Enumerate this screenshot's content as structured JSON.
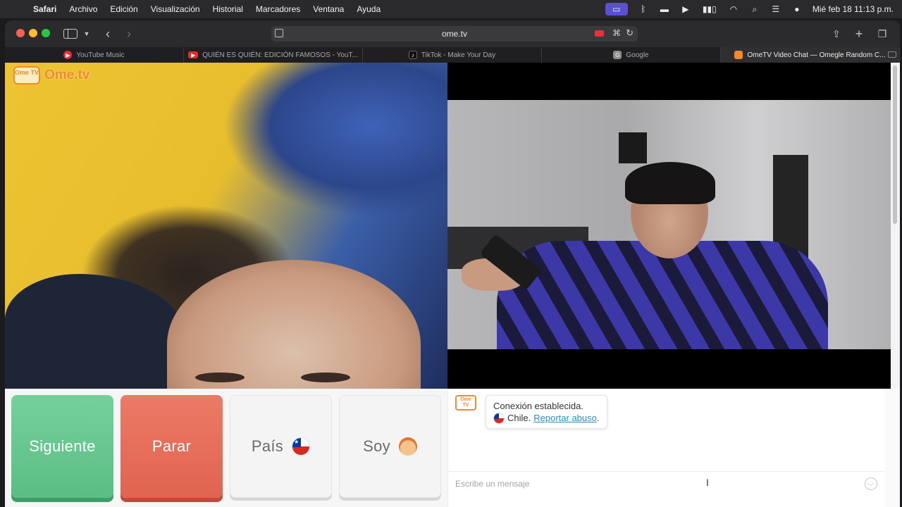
{
  "menubar": {
    "app": "Safari",
    "items": [
      "Archivo",
      "Edición",
      "Visualización",
      "Historial",
      "Marcadores",
      "Ventana",
      "Ayuda"
    ],
    "clock": "Mié feb 18  11:13 p.m."
  },
  "browser": {
    "address": "ome.tv",
    "tabs": [
      {
        "label": "YouTube Music",
        "icon": "youtube-music-icon"
      },
      {
        "label": "QUIÉN ES QUIÉN: EDICIÓN FAMOSOS - YouT...",
        "icon": "youtube-icon"
      },
      {
        "label": "TikTok - Make Your Day",
        "icon": "tiktok-icon"
      },
      {
        "label": "Google",
        "icon": "google-icon"
      },
      {
        "label": "OmeTV Video Chat — Omegle Random C...",
        "icon": "ometv-icon",
        "active": true
      }
    ]
  },
  "page": {
    "brand": {
      "logo_text": "Ome TV",
      "name": "Ome.tv"
    },
    "controls": {
      "next_label": "Siguiente",
      "stop_label": "Parar",
      "country_label": "País",
      "soy_label": "Soy"
    },
    "chat": {
      "logo_text": "Ome TV",
      "status": "Conexión establecida.",
      "country": "Chile.",
      "report_link": "Reportar abuso",
      "report_suffix": ".",
      "input_placeholder": "Escribe un mensaje"
    },
    "colors": {
      "next": "#5bbd84",
      "stop": "#e06450",
      "brand": "#f08a2c",
      "link": "#2a8fbf"
    }
  }
}
